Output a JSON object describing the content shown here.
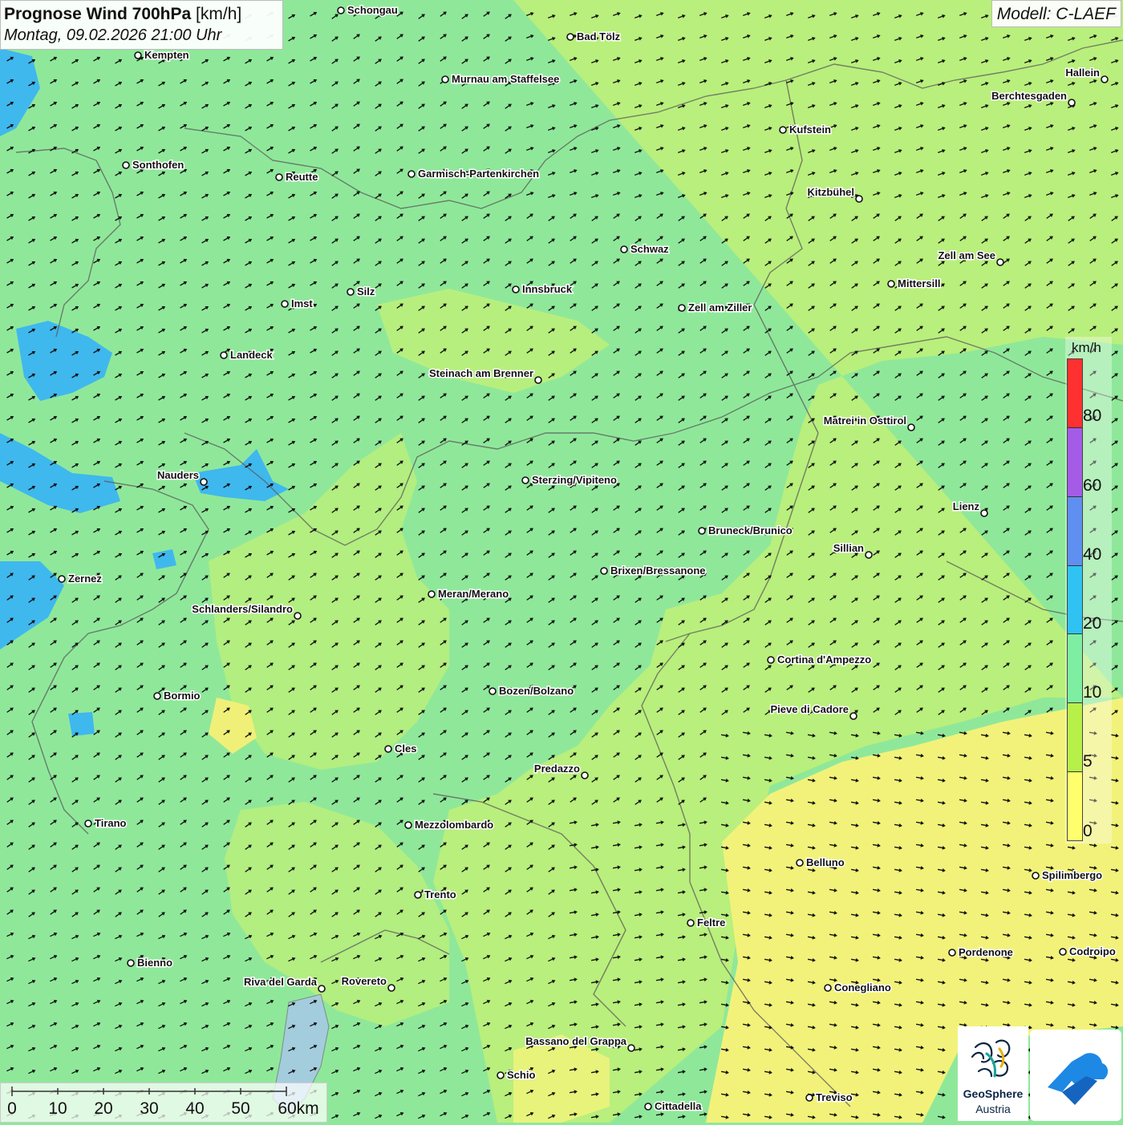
{
  "header": {
    "title_bold": "Prognose Wind 700hPa",
    "title_unit": "[km/h]",
    "datetime": "Montag, 09.02.2026 21:00 Uhr",
    "model": "Modell: C-LAEF"
  },
  "legend": {
    "unit": "km/h",
    "ticks": [
      "80",
      "60",
      "40",
      "20",
      "10",
      "5",
      "0"
    ],
    "colors": [
      "#ff3030",
      "#a45ce6",
      "#5f8ff0",
      "#2fc2f2",
      "#7eeea3",
      "#b8f04a",
      "#ffff6e"
    ]
  },
  "scalebar": {
    "labels": [
      "0",
      "10",
      "20",
      "30",
      "40",
      "50",
      "60km"
    ]
  },
  "map": {
    "cities": [
      "Schongau",
      "Bad Tölz",
      "Kempten",
      "Murnau am Staffelsee",
      "Hallein",
      "Berchtesgaden",
      "Kufstein",
      "Sonthofen",
      "Reutte",
      "Garmisch-Partenkirchen",
      "Kitzbühel",
      "Schwaz",
      "Zell am See",
      "Mittersill",
      "Innsbruck",
      "Imst",
      "Silz",
      "Zell am Ziller",
      "Landeck",
      "Steinach am Brenner",
      "Matrei in Osttirol",
      "Nauders",
      "Sterzing/Vipiteno",
      "Lienz",
      "Bruneck/Brunico",
      "Sillian",
      "Zernez",
      "Brixen/Bressanone",
      "Meran/Merano",
      "Schlanders/Silandro",
      "Cortina d'Ampezzo",
      "Bozen/Bolzano",
      "Bormio",
      "Pieve di Cadore",
      "Cles",
      "Predazzo",
      "Tirano",
      "Mezzolombardo",
      "Belluno",
      "Spilimbergo",
      "Trento",
      "Feltre",
      "Pordenone",
      "Codroipo",
      "Bienno",
      "Riva del Garda",
      "Rovereto",
      "Conegliano",
      "Bassano del Grappa",
      "Schio",
      "Treviso",
      "Cittadella"
    ]
  },
  "logos": {
    "geosphere_line1": "GeoSphere",
    "geosphere_line2": "Austria"
  }
}
